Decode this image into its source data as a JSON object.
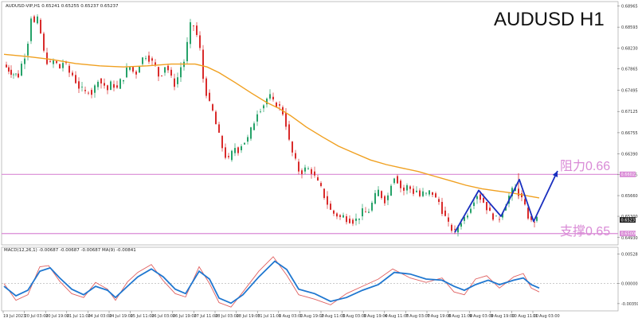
{
  "header": {
    "symbol_line": "AUDUSD-VIP,H1  0.65241 0.65255 0.65237 0.65237",
    "title": "AUDUSD H1"
  },
  "macd_header": "MACD(12,26,1) -0.00687 -0.00687 -0.00687 MA(9) -0.00841",
  "zones": {
    "resistance_label": "阻力0.66",
    "support_label": "支撑0.65",
    "resistance_value": 0.6603,
    "support_value": 0.65,
    "color": "#d98ad6"
  },
  "colors": {
    "up": "#26a269",
    "down": "#d92b2b",
    "ma": "#f0a020",
    "pattern": "#1a2fbf",
    "macd_main": "#1f77d0",
    "macd_signal": "#e06060",
    "current_price_box": "#222222"
  },
  "chart_data": [
    {
      "type": "candlestick",
      "title": "AUDUSD H1",
      "ylim": [
        0.6483,
        0.6901
      ],
      "y_ticks": [
        "0.68965",
        "0.68593",
        "0.68230",
        "0.67865",
        "0.67495",
        "0.67125",
        "0.66755",
        "0.66390",
        "0.66025",
        "0.65660",
        "0.65300",
        "0.64930"
      ],
      "y_tick_values": [
        0.68965,
        0.68593,
        0.6823,
        0.67865,
        0.67495,
        0.67125,
        0.66755,
        0.6639,
        0.66025,
        0.6566,
        0.653,
        0.6493
      ],
      "resistance_tick": "0.66023",
      "support_tick": "0.65000",
      "current_price": "0.65237",
      "current_price_value": 0.65237,
      "x_labels": [
        "19 Jul 2023",
        "20 Jul 03:00",
        "20 Jul 19:00",
        "21 Jul 11:00",
        "24 Jul 03:00",
        "24 Jul 19:00",
        "25 Jul 11:00",
        "26 Jul 03:00",
        "26 Jul 19:00",
        "27 Jul 11:00",
        "28 Jul 03:00",
        "28 Jul 19:00",
        "31 Jul 11:00",
        "1 Aug 03:00",
        "1 Aug 19:00",
        "2 Aug 11:00",
        "3 Aug 03:00",
        "3 Aug 19:00",
        "4 Aug 11:00",
        "7 Aug 03:00",
        "7 Aug 19:00",
        "8 Aug 11:00",
        "9 Aug 03:00",
        "9 Aug 19:00",
        "10 Aug 11:00",
        "11 Aug 03:00"
      ],
      "close_path": [
        [
          0,
          0.6794
        ],
        [
          6,
          0.6785
        ],
        [
          12,
          0.6778
        ],
        [
          18,
          0.6775
        ],
        [
          22,
          0.6795
        ],
        [
          26,
          0.681
        ],
        [
          30,
          0.6835
        ],
        [
          34,
          0.6878
        ],
        [
          38,
          0.6866
        ],
        [
          42,
          0.6872
        ],
        [
          46,
          0.6848
        ],
        [
          50,
          0.6815
        ],
        [
          54,
          0.68
        ],
        [
          58,
          0.6795
        ],
        [
          62,
          0.68
        ],
        [
          66,
          0.6795
        ],
        [
          70,
          0.6788
        ],
        [
          74,
          0.6798
        ],
        [
          78,
          0.6792
        ],
        [
          82,
          0.678
        ],
        [
          86,
          0.6776
        ],
        [
          90,
          0.6765
        ],
        [
          94,
          0.6755
        ],
        [
          98,
          0.675
        ],
        [
          102,
          0.6745
        ],
        [
          106,
          0.675
        ],
        [
          110,
          0.6745
        ],
        [
          114,
          0.6755
        ],
        [
          118,
          0.677
        ],
        [
          122,
          0.6762
        ],
        [
          126,
          0.6758
        ],
        [
          130,
          0.675
        ],
        [
          134,
          0.676
        ],
        [
          138,
          0.6758
        ],
        [
          142,
          0.6752
        ],
        [
          146,
          0.6765
        ],
        [
          150,
          0.6772
        ],
        [
          154,
          0.6785
        ],
        [
          158,
          0.679
        ],
        [
          162,
          0.6782
        ],
        [
          166,
          0.678
        ],
        [
          170,
          0.6795
        ],
        [
          174,
          0.6805
        ],
        [
          178,
          0.681
        ],
        [
          182,
          0.6805
        ],
        [
          186,
          0.6798
        ],
        [
          190,
          0.679
        ],
        [
          194,
          0.6775
        ],
        [
          198,
          0.678
        ],
        [
          202,
          0.6792
        ],
        [
          206,
          0.6785
        ],
        [
          210,
          0.677
        ],
        [
          214,
          0.676
        ],
        [
          218,
          0.6772
        ],
        [
          222,
          0.679
        ],
        [
          226,
          0.68
        ],
        [
          230,
          0.683
        ],
        [
          234,
          0.6862
        ],
        [
          238,
          0.6862
        ],
        [
          242,
          0.6845
        ],
        [
          246,
          0.682
        ],
        [
          250,
          0.677
        ],
        [
          254,
          0.6745
        ],
        [
          258,
          0.6725
        ],
        [
          262,
          0.6712
        ],
        [
          266,
          0.669
        ],
        [
          270,
          0.667
        ],
        [
          274,
          0.665
        ],
        [
          278,
          0.6635
        ],
        [
          282,
          0.6628
        ],
        [
          286,
          0.664
        ],
        [
          290,
          0.665
        ],
        [
          294,
          0.6645
        ],
        [
          298,
          0.6655
        ],
        [
          302,
          0.666
        ],
        [
          306,
          0.6665
        ],
        [
          310,
          0.668
        ],
        [
          314,
          0.6695
        ],
        [
          318,
          0.6712
        ],
        [
          322,
          0.6718
        ],
        [
          326,
          0.6725
        ],
        [
          330,
          0.6735
        ],
        [
          334,
          0.6738
        ],
        [
          338,
          0.6728
        ],
        [
          342,
          0.6725
        ],
        [
          346,
          0.672
        ],
        [
          350,
          0.671
        ],
        [
          354,
          0.669
        ],
        [
          358,
          0.666
        ],
        [
          362,
          0.664
        ],
        [
          366,
          0.6625
        ],
        [
          370,
          0.661
        ],
        [
          374,
          0.6608
        ],
        [
          378,
          0.6612
        ],
        [
          382,
          0.6612
        ],
        [
          386,
          0.6608
        ],
        [
          390,
          0.6598
        ],
        [
          394,
          0.6588
        ],
        [
          398,
          0.6578
        ],
        [
          402,
          0.6565
        ],
        [
          406,
          0.6552
        ],
        [
          410,
          0.654
        ],
        [
          414,
          0.6535
        ],
        [
          418,
          0.6532
        ],
        [
          422,
          0.6528
        ],
        [
          426,
          0.653
        ],
        [
          430,
          0.6526
        ],
        [
          434,
          0.6524
        ],
        [
          438,
          0.6522
        ],
        [
          442,
          0.6524
        ],
        [
          446,
          0.653
        ],
        [
          450,
          0.6538
        ],
        [
          454,
          0.6536
        ],
        [
          458,
          0.654
        ],
        [
          462,
          0.6552
        ],
        [
          466,
          0.6565
        ],
        [
          470,
          0.6574
        ],
        [
          474,
          0.6565
        ],
        [
          478,
          0.6558
        ],
        [
          482,
          0.6566
        ],
        [
          486,
          0.6588
        ],
        [
          490,
          0.66
        ],
        [
          494,
          0.6592
        ],
        [
          498,
          0.658
        ],
        [
          502,
          0.6575
        ],
        [
          506,
          0.6582
        ],
        [
          510,
          0.6578
        ],
        [
          514,
          0.6572
        ],
        [
          518,
          0.6575
        ],
        [
          522,
          0.6565
        ],
        [
          526,
          0.657
        ],
        [
          530,
          0.6568
        ],
        [
          534,
          0.6572
        ],
        [
          538,
          0.657
        ],
        [
          542,
          0.656
        ],
        [
          546,
          0.6555
        ],
        [
          550,
          0.654
        ],
        [
          554,
          0.6528
        ],
        [
          558,
          0.6515
        ],
        [
          562,
          0.6508
        ],
        [
          566,
          0.6502
        ],
        [
          570,
          0.6512
        ],
        [
          574,
          0.6522
        ],
        [
          578,
          0.6528
        ],
        [
          582,
          0.6536
        ],
        [
          586,
          0.6548
        ],
        [
          590,
          0.656
        ],
        [
          594,
          0.6568
        ],
        [
          598,
          0.6562
        ],
        [
          602,
          0.6555
        ],
        [
          606,
          0.6545
        ],
        [
          610,
          0.6535
        ],
        [
          614,
          0.653
        ],
        [
          618,
          0.6525
        ],
        [
          622,
          0.6528
        ],
        [
          626,
          0.654
        ],
        [
          630,
          0.6552
        ],
        [
          634,
          0.6565
        ],
        [
          638,
          0.6574
        ],
        [
          642,
          0.6578
        ],
        [
          646,
          0.657
        ],
        [
          650,
          0.656
        ],
        [
          654,
          0.6545
        ],
        [
          658,
          0.653
        ],
        [
          662,
          0.652
        ],
        [
          666,
          0.6522
        ],
        [
          669,
          0.6524
        ]
      ],
      "ma_path": [
        [
          0,
          0.6812
        ],
        [
          30,
          0.6808
        ],
        [
          60,
          0.6803
        ],
        [
          90,
          0.6796
        ],
        [
          120,
          0.6792
        ],
        [
          150,
          0.679
        ],
        [
          180,
          0.6792
        ],
        [
          210,
          0.6795
        ],
        [
          240,
          0.6795
        ],
        [
          255,
          0.679
        ],
        [
          270,
          0.678
        ],
        [
          290,
          0.6763
        ],
        [
          310,
          0.6745
        ],
        [
          330,
          0.6728
        ],
        [
          345,
          0.6718
        ],
        [
          360,
          0.6705
        ],
        [
          380,
          0.6685
        ],
        [
          400,
          0.6668
        ],
        [
          420,
          0.6652
        ],
        [
          440,
          0.664
        ],
        [
          460,
          0.6628
        ],
        [
          480,
          0.662
        ],
        [
          500,
          0.6614
        ],
        [
          520,
          0.6608
        ],
        [
          540,
          0.66
        ],
        [
          560,
          0.6592
        ],
        [
          580,
          0.6584
        ],
        [
          600,
          0.6578
        ],
        [
          620,
          0.6574
        ],
        [
          640,
          0.657
        ],
        [
          660,
          0.6565
        ],
        [
          672,
          0.6562
        ]
      ],
      "pattern_path": [
        [
          566,
          0.6502
        ],
        [
          596,
          0.6575
        ],
        [
          624,
          0.653
        ],
        [
          647,
          0.6594
        ],
        [
          665,
          0.6521
        ],
        [
          695,
          0.6609
        ]
      ]
    },
    {
      "type": "line",
      "title": "MACD(12,26,1)",
      "y_ticks": [
        "0.00528",
        "0.00000",
        "-0.00359"
      ],
      "ylim": [
        -0.0046,
        0.0062
      ],
      "series": [
        {
          "name": "MACD",
          "values": [
            [
              0,
              -0.0005
            ],
            [
              15,
              -0.0022
            ],
            [
              30,
              -0.0012
            ],
            [
              45,
              0.0022
            ],
            [
              58,
              0.0028
            ],
            [
              70,
              0.001
            ],
            [
              85,
              -0.001
            ],
            [
              100,
              -0.002
            ],
            [
              115,
              -0.0005
            ],
            [
              130,
              -0.0012
            ],
            [
              140,
              -0.0025
            ],
            [
              155,
              -0.0005
            ],
            [
              168,
              0.0012
            ],
            [
              185,
              0.0026
            ],
            [
              200,
              0.0012
            ],
            [
              215,
              -0.001
            ],
            [
              228,
              -0.0018
            ],
            [
              245,
              0.0022
            ],
            [
              258,
              0.0008
            ],
            [
              270,
              -0.0026
            ],
            [
              285,
              -0.0035
            ],
            [
              300,
              -0.002
            ],
            [
              320,
              0.0012
            ],
            [
              340,
              0.004
            ],
            [
              355,
              0.0025
            ],
            [
              370,
              -0.001
            ],
            [
              390,
              -0.0018
            ],
            [
              410,
              -0.0032
            ],
            [
              430,
              -0.0025
            ],
            [
              450,
              -0.0012
            ],
            [
              470,
              -0.0002
            ],
            [
              490,
              0.002
            ],
            [
              510,
              0.0017
            ],
            [
              530,
              0.0008
            ],
            [
              550,
              0.0006
            ],
            [
              565,
              -0.0005
            ],
            [
              578,
              -0.0012
            ],
            [
              592,
              -0.0002
            ],
            [
              608,
              0.0006
            ],
            [
              622,
              -0.0002
            ],
            [
              640,
              0.0006
            ],
            [
              652,
              0.001
            ],
            [
              662,
              -0.0002
            ],
            [
              672,
              -0.0008
            ]
          ]
        },
        {
          "name": "MA(9)",
          "values": [
            [
              0,
              0.0
            ],
            [
              15,
              -0.003
            ],
            [
              30,
              -0.002
            ],
            [
              45,
              0.003
            ],
            [
              56,
              0.0032
            ],
            [
              70,
              0.0004
            ],
            [
              85,
              -0.0018
            ],
            [
              100,
              -0.0025
            ],
            [
              115,
              0.0002
            ],
            [
              130,
              -0.001
            ],
            [
              140,
              -0.003
            ],
            [
              155,
              0.0003
            ],
            [
              168,
              0.002
            ],
            [
              185,
              0.0034
            ],
            [
              200,
              0.0005
            ],
            [
              215,
              -0.0018
            ],
            [
              228,
              -0.0024
            ],
            [
              245,
              0.003
            ],
            [
              258,
              0.0
            ],
            [
              270,
              -0.0034
            ],
            [
              285,
              -0.0042
            ],
            [
              300,
              -0.0015
            ],
            [
              320,
              0.0022
            ],
            [
              338,
              0.0048
            ],
            [
              355,
              0.0015
            ],
            [
              370,
              -0.002
            ],
            [
              390,
              -0.0028
            ],
            [
              410,
              -0.0038
            ],
            [
              430,
              -0.0018
            ],
            [
              450,
              -0.0005
            ],
            [
              470,
              0.0008
            ],
            [
              488,
              0.0026
            ],
            [
              510,
              0.001
            ],
            [
              530,
              0.0002
            ],
            [
              550,
              0.001
            ],
            [
              565,
              -0.0015
            ],
            [
              578,
              -0.002
            ],
            [
              592,
              0.0008
            ],
            [
              606,
              0.0014
            ],
            [
              622,
              -0.0008
            ],
            [
              640,
              0.0012
            ],
            [
              652,
              0.0018
            ],
            [
              662,
              -0.0008
            ],
            [
              672,
              -0.0015
            ]
          ]
        }
      ]
    }
  ]
}
